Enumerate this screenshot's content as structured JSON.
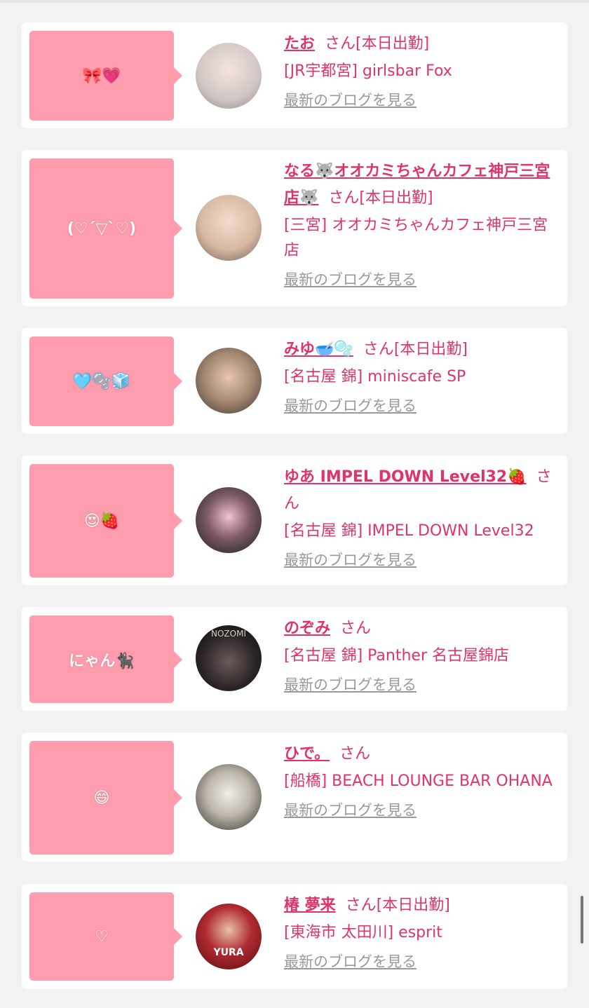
{
  "cards": [
    {
      "bubble": "🎀💗",
      "name": "たお",
      "san": "さん",
      "status": "[本日出勤]",
      "shop": "[JR宇都宮] girlsbar Fox",
      "blog": "最新のブログを見る"
    },
    {
      "bubble": "(♡´▽`♡)",
      "name": "なる🐺オオカミちゃんカフェ神戸三宮店🐺",
      "san": "さん",
      "status": "[本日出勤]",
      "shop": "[三宮] オオカミちゃんカフェ神戸三宮店",
      "blog": "最新のブログを見る"
    },
    {
      "bubble": "🩵🫧🧊",
      "name": "みゆ🥣🫧",
      "san": "さん",
      "status": "[本日出勤]",
      "shop": "[名古屋 錦] miniscafe SP",
      "blog": "最新のブログを見る"
    },
    {
      "bubble": "😍🍓",
      "name": "ゆあ IMPEL DOWN Level32🍓",
      "san": "さん",
      "status": "",
      "shop": "[名古屋 錦] IMPEL DOWN Level32",
      "blog": "最新のブログを見る"
    },
    {
      "bubble": "にゃん🐈‍⬛",
      "name": "のぞみ",
      "san": "さん",
      "status": "",
      "shop": "[名古屋 錦] Panther 名古屋錦店",
      "blog": "最新のブログを見る"
    },
    {
      "bubble": "😄",
      "name": "ひで。",
      "san": "さん",
      "status": "",
      "shop": "[船橋] BEACH LOUNGE BAR OHANA",
      "blog": "最新のブログを見る"
    },
    {
      "bubble": "♡",
      "name": "椿 夢来",
      "san": "さん",
      "status": "[本日出勤]",
      "shop": "[東海市 太田川] esprit",
      "blog": "最新のブログを見る"
    }
  ],
  "avatars": {
    "c0": "#d9d4d0",
    "c1": "#e8d6c8",
    "c2": "#7a6a5c",
    "c3": "#3a3338",
    "c4": "#1e1b1d",
    "c5": "#3b3a36",
    "c6": "#8e1a1f"
  },
  "avatar_labels": {
    "a2": "NOZOMI",
    "a6": "YURA"
  }
}
